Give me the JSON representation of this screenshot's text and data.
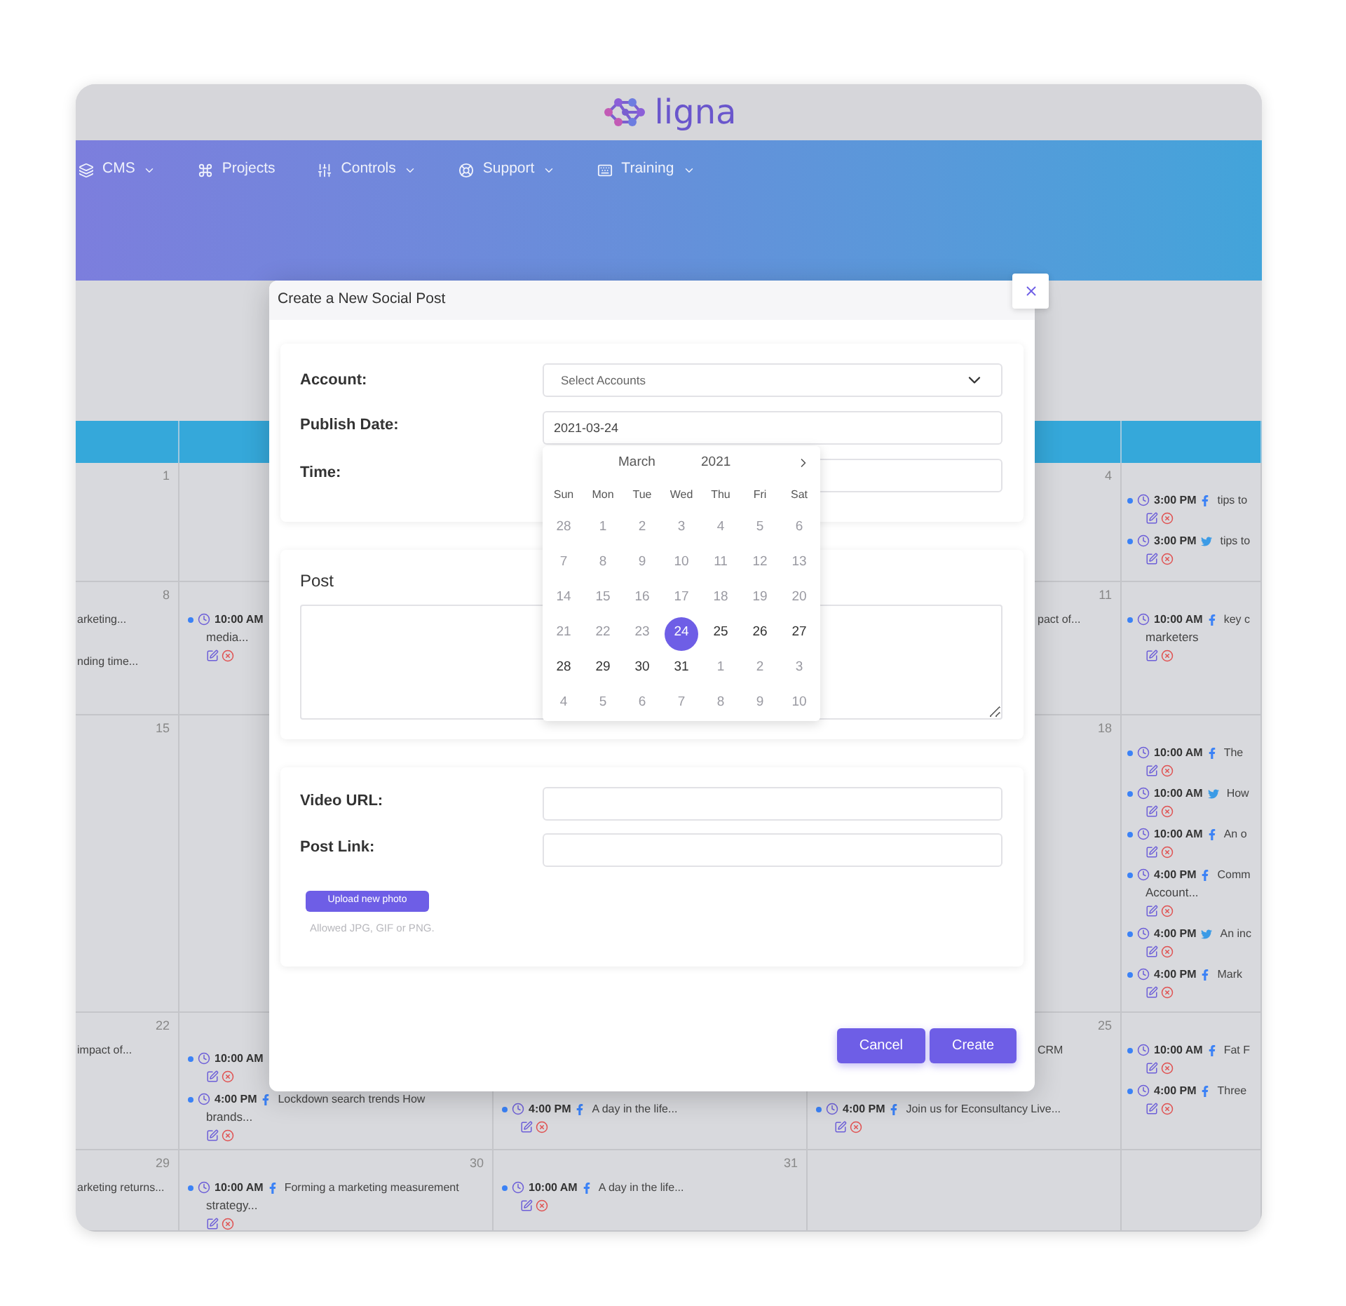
{
  "logo": {
    "text": "ligna"
  },
  "nav": [
    {
      "label": "CMS",
      "dropdown": true
    },
    {
      "label": "Projects",
      "dropdown": false
    },
    {
      "label": "Controls",
      "dropdown": true
    },
    {
      "label": "Support",
      "dropdown": true
    },
    {
      "label": "Training",
      "dropdown": true
    }
  ],
  "calendar": {
    "weeks": [
      {
        "cells": [
          {
            "date": "1"
          },
          {},
          {},
          {
            "date": "4"
          },
          {
            "items": [
              {
                "kind": "facebook",
                "time": "3:00 PM",
                "title": "tips to"
              },
              {
                "kind": "twitter",
                "time": "3:00 PM",
                "title": "tips to"
              }
            ]
          }
        ]
      },
      {
        "cells": [
          {
            "date": "8",
            "items": [
              {
                "kind": "snippet",
                "text": "arketing..."
              },
              {
                "kind": "snippet",
                "text": "nding time..."
              }
            ]
          },
          {
            "items": [
              {
                "kind": "event",
                "time": "10:00 AM",
                "more": "media..."
              }
            ]
          },
          {},
          {
            "date": "11",
            "items": [
              {
                "kind": "snippet",
                "text": "pact of..."
              }
            ]
          },
          {
            "items": [
              {
                "kind": "facebook",
                "time": "10:00 AM",
                "title": "key c",
                "more": "marketers"
              }
            ]
          }
        ]
      },
      {
        "cells": [
          {
            "date": "15"
          },
          {},
          {},
          {
            "date": "18"
          },
          {
            "items": [
              {
                "kind": "facebook",
                "time": "10:00 AM",
                "title": "The"
              },
              {
                "kind": "twitter",
                "time": "10:00 AM",
                "title": "How"
              },
              {
                "kind": "facebook",
                "time": "10:00 AM",
                "title": "An o"
              },
              {
                "kind": "facebook",
                "time": "4:00 PM",
                "title": "Comm",
                "more": "Account..."
              },
              {
                "kind": "twitter",
                "time": "4:00 PM",
                "title": "An inc"
              },
              {
                "kind": "facebook",
                "time": "4:00 PM",
                "title": "Mark"
              }
            ]
          }
        ]
      },
      {
        "cells": [
          {
            "date": "22",
            "items": [
              {
                "kind": "snippet",
                "text": "impact of..."
              }
            ]
          },
          {
            "items": [
              {
                "kind": "event",
                "time": "10:00 AM"
              },
              {
                "kind": "facebook",
                "time": "4:00 PM",
                "title": "Lockdown search trends How",
                "more": "brands..."
              }
            ]
          },
          {
            "items": [
              {
                "kind": "facebook",
                "time": "4:00 PM",
                "title": "A day in the life..."
              }
            ]
          },
          {
            "date": "25",
            "items": [
              {
                "kind": "snippet",
                "text": "CRM"
              },
              {
                "kind": "facebook",
                "time": "4:00 PM",
                "title": "Join us for Econsultancy Live..."
              }
            ]
          },
          {
            "items": [
              {
                "kind": "facebook",
                "time": "10:00 AM",
                "title": "Fat F"
              },
              {
                "kind": "facebook",
                "time": "4:00 PM",
                "title": "Three"
              }
            ]
          }
        ]
      },
      {
        "cells": [
          {
            "date": "29",
            "items": [
              {
                "kind": "snippet",
                "text": "arketing returns..."
              }
            ]
          },
          {
            "date": "30",
            "items": [
              {
                "kind": "facebook",
                "time": "10:00 AM",
                "title": "Forming a marketing measurement",
                "more": "strategy..."
              }
            ]
          },
          {
            "date": "31",
            "items": [
              {
                "kind": "facebook",
                "time": "10:00 AM",
                "title": "A day in the life..."
              }
            ]
          },
          {},
          {}
        ]
      }
    ]
  },
  "modal": {
    "title": "Create a New Social Post",
    "account": {
      "label": "Account:",
      "placeholder": "Select Accounts"
    },
    "publish_date": {
      "label": "Publish Date:",
      "value": "2021-03-24"
    },
    "time": {
      "label": "Time:"
    },
    "datepicker": {
      "month": "March",
      "year": "2021",
      "weekdays": [
        "Sun",
        "Mon",
        "Tue",
        "Wed",
        "Thu",
        "Fri",
        "Sat"
      ],
      "weeks": [
        [
          {
            "day": "28",
            "disabled": true,
            "selected": false
          },
          {
            "day": "1",
            "disabled": true,
            "selected": false
          },
          {
            "day": "2",
            "disabled": true,
            "selected": false
          },
          {
            "day": "3",
            "disabled": true,
            "selected": false
          },
          {
            "day": "4",
            "disabled": true,
            "selected": false
          },
          {
            "day": "5",
            "disabled": true,
            "selected": false
          },
          {
            "day": "6",
            "disabled": true,
            "selected": false
          }
        ],
        [
          {
            "day": "7",
            "disabled": true,
            "selected": false
          },
          {
            "day": "8",
            "disabled": true,
            "selected": false
          },
          {
            "day": "9",
            "disabled": true,
            "selected": false
          },
          {
            "day": "10",
            "disabled": true,
            "selected": false
          },
          {
            "day": "11",
            "disabled": true,
            "selected": false
          },
          {
            "day": "12",
            "disabled": true,
            "selected": false
          },
          {
            "day": "13",
            "disabled": true,
            "selected": false
          }
        ],
        [
          {
            "day": "14",
            "disabled": true,
            "selected": false
          },
          {
            "day": "15",
            "disabled": true,
            "selected": false
          },
          {
            "day": "16",
            "disabled": true,
            "selected": false
          },
          {
            "day": "17",
            "disabled": true,
            "selected": false
          },
          {
            "day": "18",
            "disabled": true,
            "selected": false
          },
          {
            "day": "19",
            "disabled": true,
            "selected": false
          },
          {
            "day": "20",
            "disabled": true,
            "selected": false
          }
        ],
        [
          {
            "day": "21",
            "disabled": true,
            "selected": false
          },
          {
            "day": "22",
            "disabled": true,
            "selected": false
          },
          {
            "day": "23",
            "disabled": true,
            "selected": false
          },
          {
            "day": "24",
            "disabled": false,
            "selected": true
          },
          {
            "day": "25",
            "disabled": false,
            "selected": false
          },
          {
            "day": "26",
            "disabled": false,
            "selected": false
          },
          {
            "day": "27",
            "disabled": false,
            "selected": false
          }
        ],
        [
          {
            "day": "28",
            "disabled": false,
            "selected": false
          },
          {
            "day": "29",
            "disabled": false,
            "selected": false
          },
          {
            "day": "30",
            "disabled": false,
            "selected": false
          },
          {
            "day": "31",
            "disabled": false,
            "selected": false
          },
          {
            "day": "1",
            "disabled": true,
            "selected": false
          },
          {
            "day": "2",
            "disabled": true,
            "selected": false
          },
          {
            "day": "3",
            "disabled": true,
            "selected": false
          }
        ],
        [
          {
            "day": "4",
            "disabled": true,
            "selected": false
          },
          {
            "day": "5",
            "disabled": true,
            "selected": false
          },
          {
            "day": "6",
            "disabled": true,
            "selected": false
          },
          {
            "day": "7",
            "disabled": true,
            "selected": false
          },
          {
            "day": "8",
            "disabled": true,
            "selected": false
          },
          {
            "day": "9",
            "disabled": true,
            "selected": false
          },
          {
            "day": "10",
            "disabled": true,
            "selected": false
          }
        ]
      ]
    },
    "post": {
      "title": "Post"
    },
    "video_url": {
      "label": "Video URL:"
    },
    "post_link": {
      "label": "Post Link:"
    },
    "upload": {
      "button": "Upload new photo",
      "hint": "Allowed JPG, GIF or PNG."
    },
    "actions": [
      "Cancel",
      "Create"
    ]
  }
}
